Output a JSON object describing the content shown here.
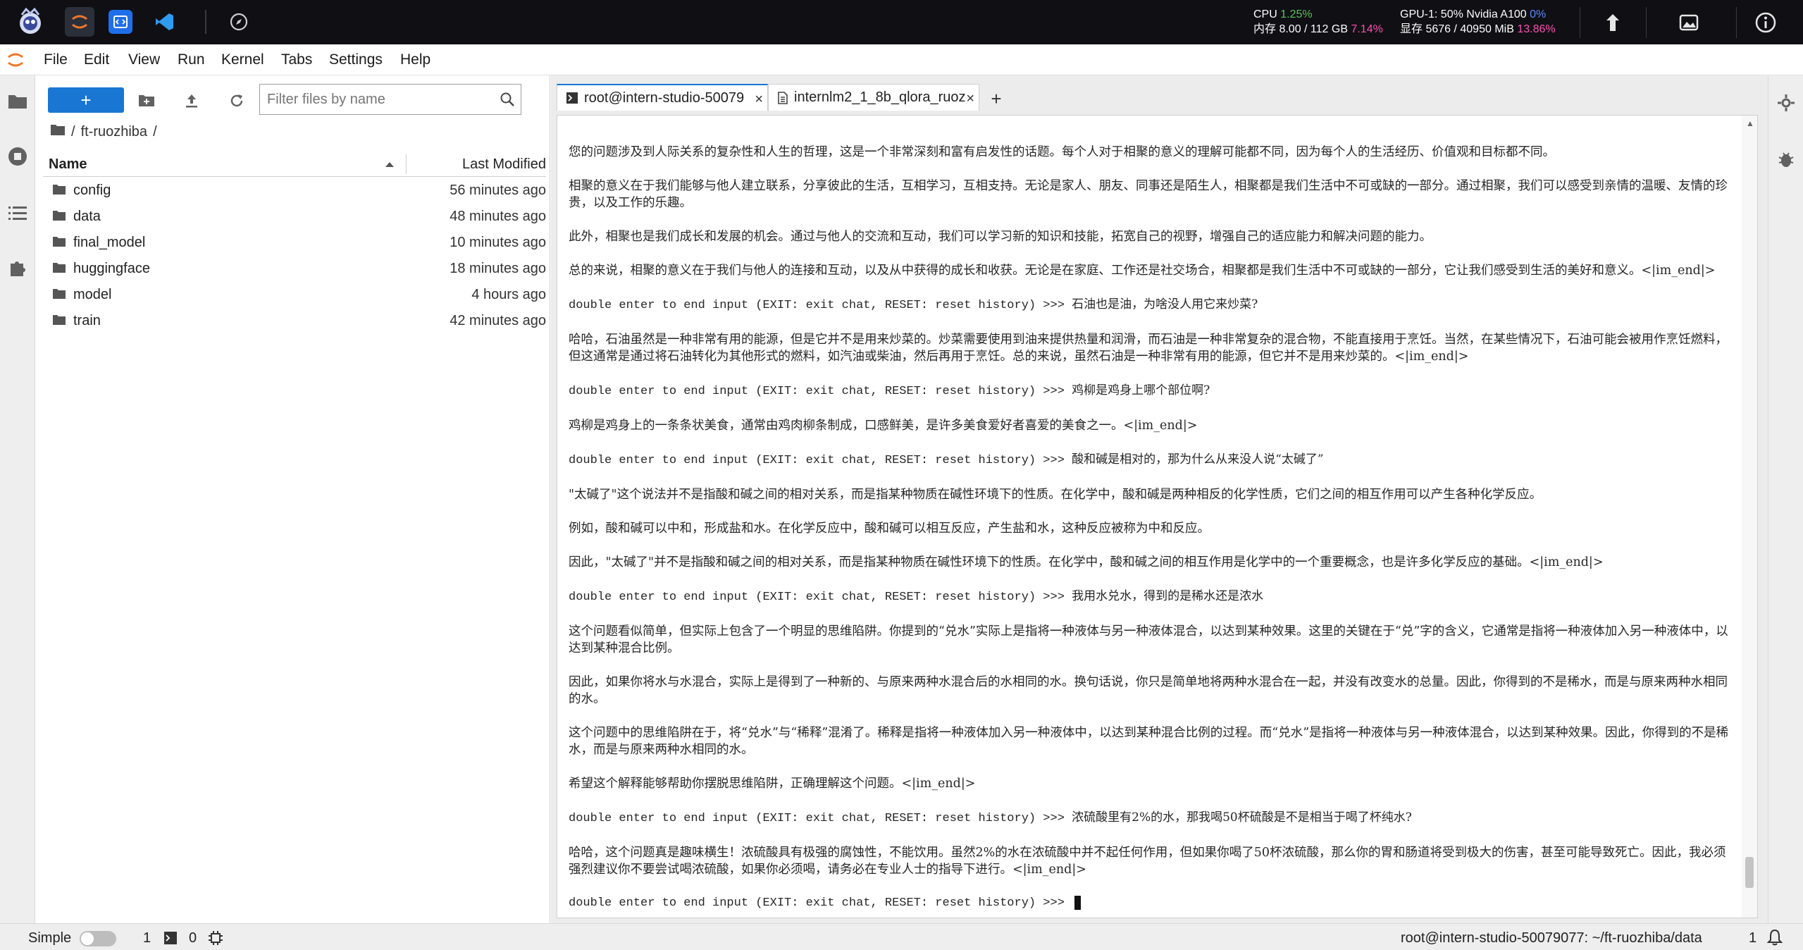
{
  "topbar": {
    "cpu_label": "CPU",
    "cpu_value": "1.25%",
    "mem_label": "内存 8.00 / 112 GB",
    "mem_value": "7.14%",
    "gpu_label": "GPU-1: 50% Nvidia A100",
    "gpu_value": "0%",
    "vram_label": "显存 5676 / 40950 MiB",
    "vram_value": "13.86%"
  },
  "menu": [
    "File",
    "Edit",
    "View",
    "Run",
    "Kernel",
    "Tabs",
    "Settings",
    "Help"
  ],
  "filebrowser": {
    "new_label": "+",
    "filter_placeholder": "Filter files by name",
    "breadcrumb_root": "/",
    "breadcrumb_folder": "ft-ruozhiba",
    "breadcrumb_sep": "/",
    "col_name": "Name",
    "col_modified": "Last Modified",
    "files": [
      {
        "name": "config",
        "modified": "56 minutes ago"
      },
      {
        "name": "data",
        "modified": "48 minutes ago"
      },
      {
        "name": "final_model",
        "modified": "10 minutes ago"
      },
      {
        "name": "huggingface",
        "modified": "18 minutes ago"
      },
      {
        "name": "model",
        "modified": "4 hours ago"
      },
      {
        "name": "train",
        "modified": "42 minutes ago"
      }
    ]
  },
  "tabs": [
    {
      "title": "root@intern-studio-50079",
      "close": "×"
    },
    {
      "title": "internlm2_1_8b_qlora_ruoz",
      "close": "×"
    }
  ],
  "add_tab": "+",
  "terminal": {
    "prompt": "double enter to end input (EXIT: exit chat, RESET: reset history) >>> ",
    "lines": [
      {
        "kind": "out",
        "text": "您的问题涉及到人际关系的复杂性和人生的哲理，这是一个非常深刻和富有启发性的话题。每个人对于相聚的意义的理解可能都不同，因为每个人的生活经历、价值观和目标都不同。"
      },
      {
        "kind": "out",
        "text": "相聚的意义在于我们能够与他人建立联系，分享彼此的生活，互相学习，互相支持。无论是家人、朋友、同事还是陌生人，相聚都是我们生活中不可或缺的一部分。通过相聚，我们可以感受到亲情的温暖、友情的珍贵，以及工作的乐趣。"
      },
      {
        "kind": "out",
        "text": "此外，相聚也是我们成长和发展的机会。通过与他人的交流和互动，我们可以学习新的知识和技能，拓宽自己的视野，增强自己的适应能力和解决问题的能力。"
      },
      {
        "kind": "out",
        "text": "总的来说，相聚的意义在于我们与他人的连接和互动，以及从中获得的成长和收获。无论是在家庭、工作还是社交场合，相聚都是我们生活中不可或缺的一部分，它让我们感受到生活的美好和意义。<|im_end|>"
      },
      {
        "kind": "prompt",
        "text": "石油也是油，为啥没人用它来炒菜?"
      },
      {
        "kind": "out",
        "text": "哈哈，石油虽然是一种非常有用的能源，但是它并不是用来炒菜的。炒菜需要使用到油来提供热量和润滑，而石油是一种非常复杂的混合物，不能直接用于烹饪。当然，在某些情况下，石油可能会被用作烹饪燃料，但这通常是通过将石油转化为其他形式的燃料，如汽油或柴油，然后再用于烹饪。总的来说，虽然石油是一种非常有用的能源，但它并不是用来炒菜的。<|im_end|>"
      },
      {
        "kind": "prompt",
        "text": "鸡柳是鸡身上哪个部位啊?"
      },
      {
        "kind": "out",
        "text": "鸡柳是鸡身上的一条条状美食，通常由鸡肉柳条制成，口感鲜美，是许多美食爱好者喜爱的美食之一。<|im_end|>"
      },
      {
        "kind": "prompt",
        "text": "酸和碱是相对的，那为什么从来没人说“太碱了”"
      },
      {
        "kind": "out",
        "text": "\"太碱了\"这个说法并不是指酸和碱之间的相对关系，而是指某种物质在碱性环境下的性质。在化学中，酸和碱是两种相反的化学性质，它们之间的相互作用可以产生各种化学反应。"
      },
      {
        "kind": "out",
        "text": "例如，酸和碱可以中和，形成盐和水。在化学反应中，酸和碱可以相互反应，产生盐和水，这种反应被称为中和反应。"
      },
      {
        "kind": "out",
        "text": "因此，\"太碱了\"并不是指酸和碱之间的相对关系，而是指某种物质在碱性环境下的性质。在化学中，酸和碱之间的相互作用是化学中的一个重要概念，也是许多化学反应的基础。<|im_end|>"
      },
      {
        "kind": "prompt",
        "text": "我用水兑水，得到的是稀水还是浓水"
      },
      {
        "kind": "out",
        "text": "这个问题看似简单，但实际上包含了一个明显的思维陷阱。你提到的“兑水”实际上是指将一种液体与另一种液体混合，以达到某种效果。这里的关键在于“兑”字的含义，它通常是指将一种液体加入另一种液体中，以达到某种混合比例。"
      },
      {
        "kind": "out",
        "text": "因此，如果你将水与水混合，实际上是得到了一种新的、与原来两种水混合后的水相同的水。换句话说，你只是简单地将两种水混合在一起，并没有改变水的总量。因此，你得到的不是稀水，而是与原来两种水相同的水。"
      },
      {
        "kind": "out",
        "text": "这个问题中的思维陷阱在于，将“兑水”与“稀释”混淆了。稀释是指将一种液体加入另一种液体中，以达到某种混合比例的过程。而“兑水”是指将一种液体与另一种液体混合，以达到某种效果。因此，你得到的不是稀水，而是与原来两种水相同的水。"
      },
      {
        "kind": "out",
        "text": "希望这个解释能够帮助你摆脱思维陷阱，正确理解这个问题。<|im_end|>"
      },
      {
        "kind": "prompt",
        "text": "浓硫酸里有2%的水，那我喝50杯硫酸是不是相当于喝了杯纯水?"
      },
      {
        "kind": "out",
        "text": "哈哈，这个问题真是趣味横生！浓硫酸具有极强的腐蚀性，不能饮用。虽然2%的水在浓硫酸中并不起任何作用，但如果你喝了50杯浓硫酸，那么你的胃和肠道将受到极大的伤害，甚至可能导致死亡。因此，我必须强烈建议你不要尝试喝浓硫酸，如果你必须喝，请务必在专业人士的指导下进行。<|im_end|>"
      },
      {
        "kind": "cursor",
        "text": ""
      }
    ]
  },
  "statusbar": {
    "mode": "Simple",
    "terminals": "1",
    "kernels": "0",
    "path": "root@intern-studio-50079077: ~/ft-ruozhiba/data",
    "count": "1"
  }
}
